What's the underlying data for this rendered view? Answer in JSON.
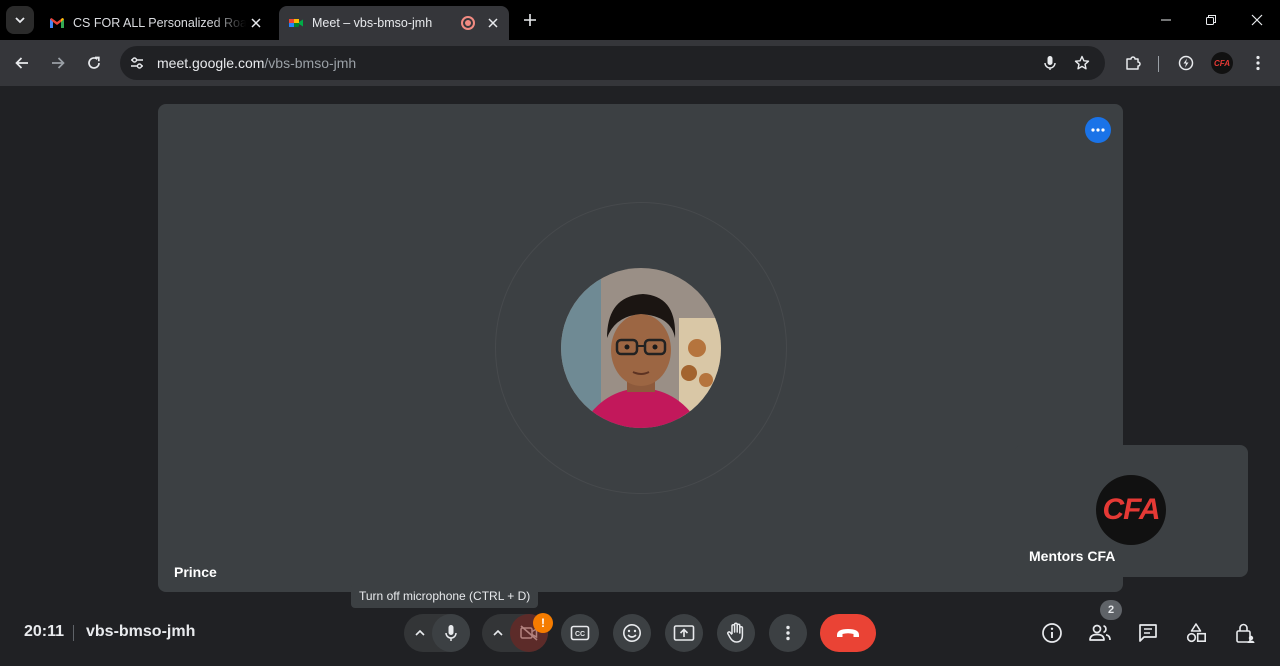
{
  "browser": {
    "tabs": [
      {
        "title": "CS FOR ALL Personalized Roadmap",
        "favicon": "gmail-icon"
      },
      {
        "title": "Meet – vbs-bmso-jmh",
        "favicon": "meet-icon",
        "recording": true
      }
    ],
    "url_host": "meet.google.com",
    "url_path": "/vbs-bmso-jmh",
    "profile_label": "CFA"
  },
  "meet": {
    "main_participant": {
      "name": "Prince"
    },
    "side_participant": {
      "name": "Mentors CFA",
      "logo_text": "CFA"
    },
    "tooltip": "Turn off microphone (CTRL + D)",
    "clock": "20:11",
    "meeting_code": "vbs-bmso-jmh",
    "camera_warning_badge": "!",
    "people_count": "2"
  },
  "colors": {
    "end_call": "#ea4335",
    "more_button": "#1a73e8",
    "warning": "#f57c00",
    "background": "#202124"
  }
}
